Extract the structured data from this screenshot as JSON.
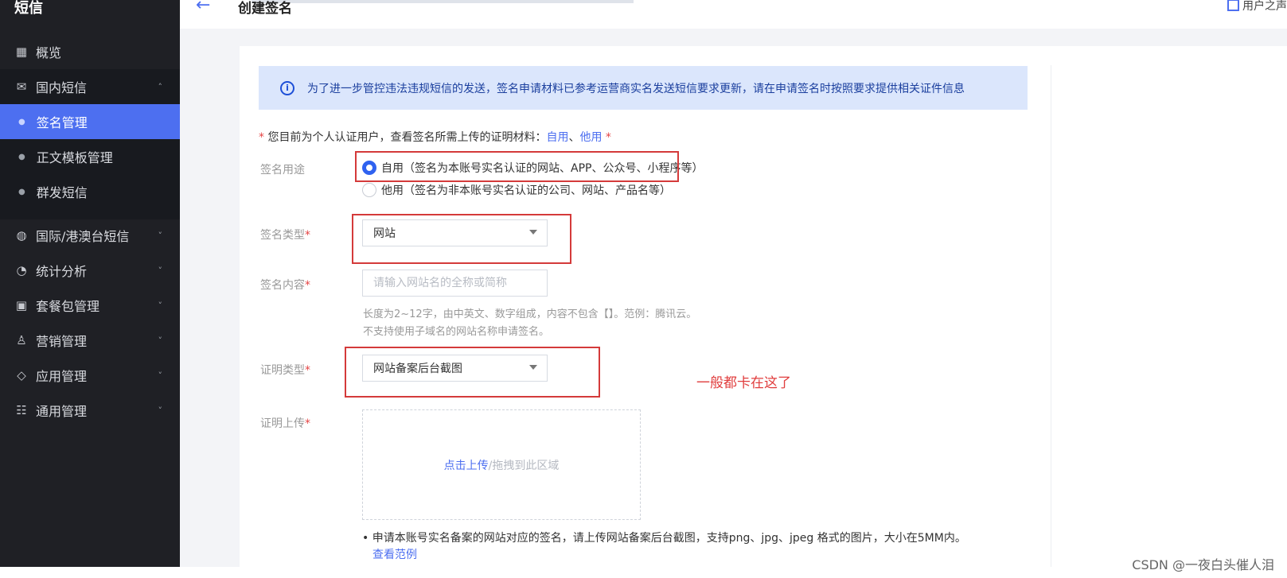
{
  "sidebar": {
    "title": "短信",
    "items": [
      {
        "label": "概览",
        "icon": "grid-icon",
        "glyph": "▦"
      },
      {
        "label": "国内短信",
        "icon": "mail-icon",
        "glyph": "✉",
        "chevron": "˄"
      },
      {
        "label": "国际/港澳台短信",
        "icon": "globe-icon",
        "glyph": "◍",
        "chevron": "˅"
      },
      {
        "label": "统计分析",
        "icon": "pie-chart-icon",
        "glyph": "◔",
        "chevron": "˅"
      },
      {
        "label": "套餐包管理",
        "icon": "package-icon",
        "glyph": "▣",
        "chevron": "˅"
      },
      {
        "label": "营销管理",
        "icon": "users-icon",
        "glyph": "♙",
        "chevron": "˅"
      },
      {
        "label": "应用管理",
        "icon": "layers-icon",
        "glyph": "◇",
        "chevron": "˅"
      },
      {
        "label": "通用管理",
        "icon": "sliders-icon",
        "glyph": "☷",
        "chevron": "˅"
      }
    ],
    "subitems": [
      {
        "label": "签名管理"
      },
      {
        "label": "正文模板管理"
      },
      {
        "label": "群发短信"
      }
    ]
  },
  "header": {
    "title": "创建签名",
    "right_label": "用户之声"
  },
  "notice": "为了进一步管控违法违规短信的发送，签名申请材料已参考运营商实名发送短信要求更新，请在申请签名时按照要求提供相关证件信息",
  "hint": {
    "prefix": "您目前为个人认证用户，查看签名所需上传的证明材料：",
    "link1": "自用",
    "sep": "、",
    "link2": "他用"
  },
  "form": {
    "usage_label": "签名用途",
    "usage_options": [
      "自用（签名为本账号实名认证的网站、APP、公众号、小程序等）",
      "他用（签名为非本账号实名认证的公司、网站、产品名等）"
    ],
    "type_label": "签名类型",
    "type_value": "网站",
    "content_label": "签名内容",
    "content_placeholder": "请输入网站名的全称或简称",
    "content_help1": "长度为2~12字，由中英文、数字组成，内容不包含【】。范例：腾讯云。",
    "content_help2": "不支持使用子域名的网站名称申请签名。",
    "proof_type_label": "证明类型",
    "proof_type_value": "网站备案后台截图",
    "upload_label": "证明上传",
    "upload_link": "点击上传",
    "upload_hint": "/拖拽到此区域",
    "upload_note": "申请本账号实名备案的网站对应的签名，请上传网站备案后台截图，支持png、jpg、jpeg 格式的图片，大小在5MM内。",
    "example_link": "查看范例"
  },
  "annotation": "一般都卡在这了",
  "watermark": "CSDN @一夜白头催人泪",
  "colors": {
    "accent": "#4d6ff0",
    "sidebar_bg": "#1f2025",
    "annotation": "#d43a3a"
  }
}
